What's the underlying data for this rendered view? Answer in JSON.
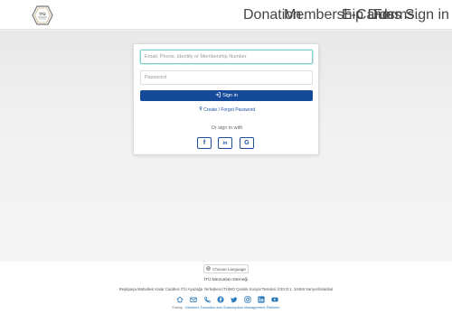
{
  "navbar": {
    "logo_alt": "İTÜ Mezunları Derneği",
    "items": [
      {
        "label": "Donation",
        "has_dropdown": true
      },
      {
        "label": "Membership Dues",
        "has_dropdown": false
      },
      {
        "label": "E-Cards",
        "has_dropdown": false
      },
      {
        "label": "Forms",
        "has_dropdown": true
      },
      {
        "label": "Sign in",
        "has_dropdown": false
      }
    ],
    "caret": "⌄"
  },
  "login": {
    "email_placeholder": "Email, Phone, Identity or Membership Number",
    "password_placeholder": "Password",
    "signin_label": "Sign in",
    "forgot_label": "Create / Forgot Password",
    "or_label": "Or sign in with",
    "social": [
      {
        "name": "facebook",
        "glyph": "f"
      },
      {
        "name": "linkedin",
        "glyph": "in"
      },
      {
        "name": "google",
        "glyph": "G"
      }
    ]
  },
  "footer": {
    "language_label": "Choose Language",
    "org_name": "İTÜ Mezunları Derneği",
    "address": "Reşitpaşa Mahallesi Katar Caddesi İTÜ Ayazağa Yerleşkesi İTÜMO Çamlık Sosyal Tesisleri 2/33 D:1, 34469 Sarıyer/İstanbul",
    "powered_prefix": "Forinp - ",
    "powered_link": "Member, Donation and Subscription Management Platform",
    "icons": [
      "home-icon",
      "mail-icon",
      "phone-icon",
      "facebook-icon",
      "twitter-icon",
      "instagram-icon",
      "linkedin-icon",
      "youtube-icon"
    ]
  },
  "colors": {
    "primary": "#144a98",
    "link": "#1a4f9e",
    "focus_border": "#7fd0c8",
    "footer_icon": "#2a78b8"
  }
}
